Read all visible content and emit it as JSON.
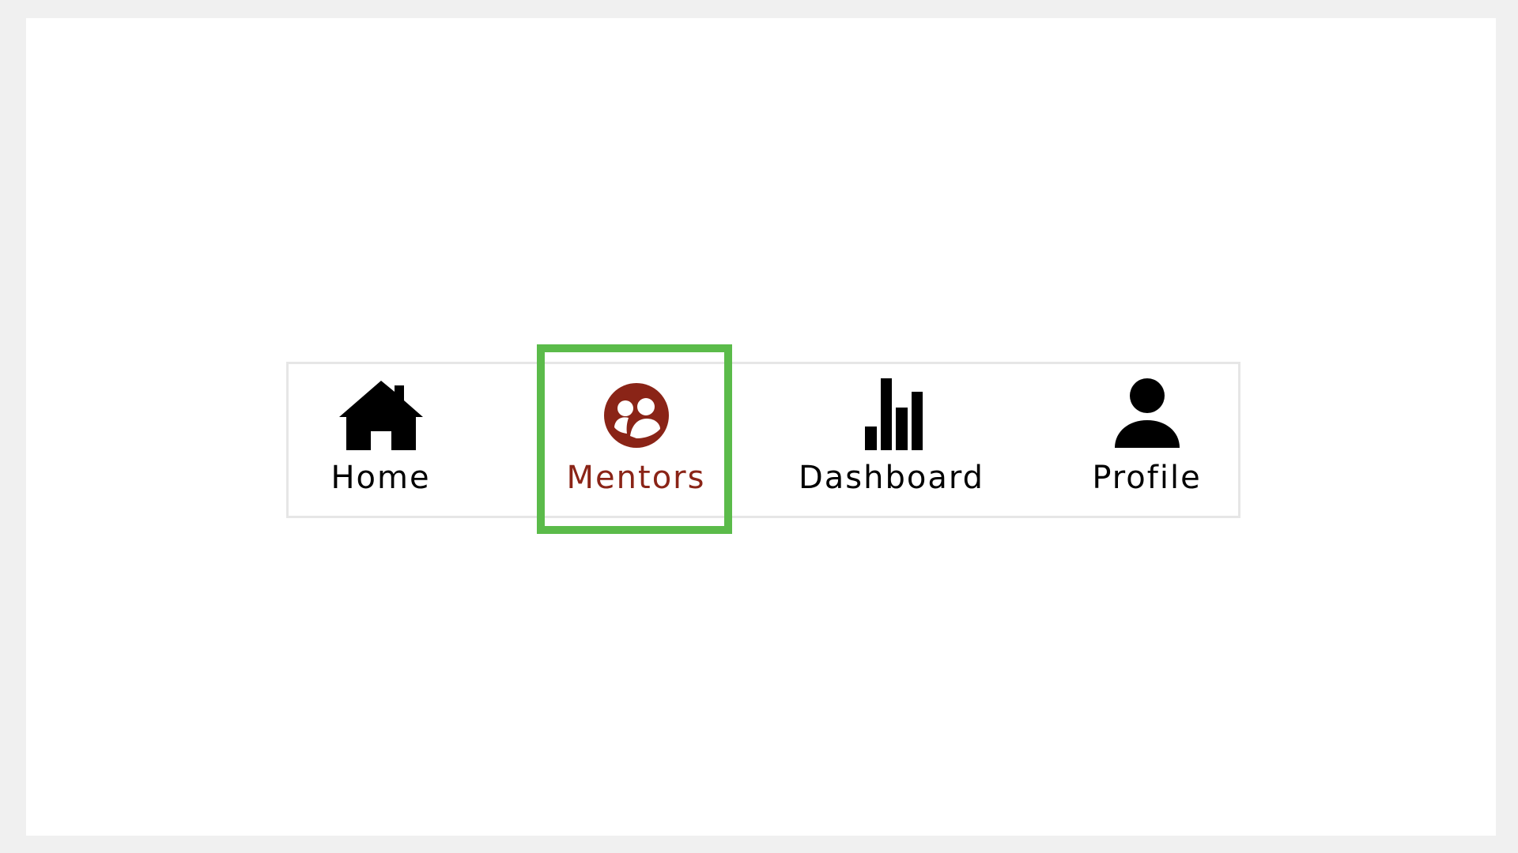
{
  "nav": {
    "items": [
      {
        "label": "Home",
        "icon": "home-icon",
        "active": false
      },
      {
        "label": "Mentors",
        "icon": "mentors-icon",
        "active": true
      },
      {
        "label": "Dashboard",
        "icon": "bar-chart-icon",
        "active": false
      },
      {
        "label": "Profile",
        "icon": "user-icon",
        "active": false
      }
    ]
  },
  "colors": {
    "active": "#8a2417",
    "inactive": "#000000",
    "highlight": "#5bbb4a",
    "border": "#e6e6e6",
    "background": "#f0f0f0"
  }
}
